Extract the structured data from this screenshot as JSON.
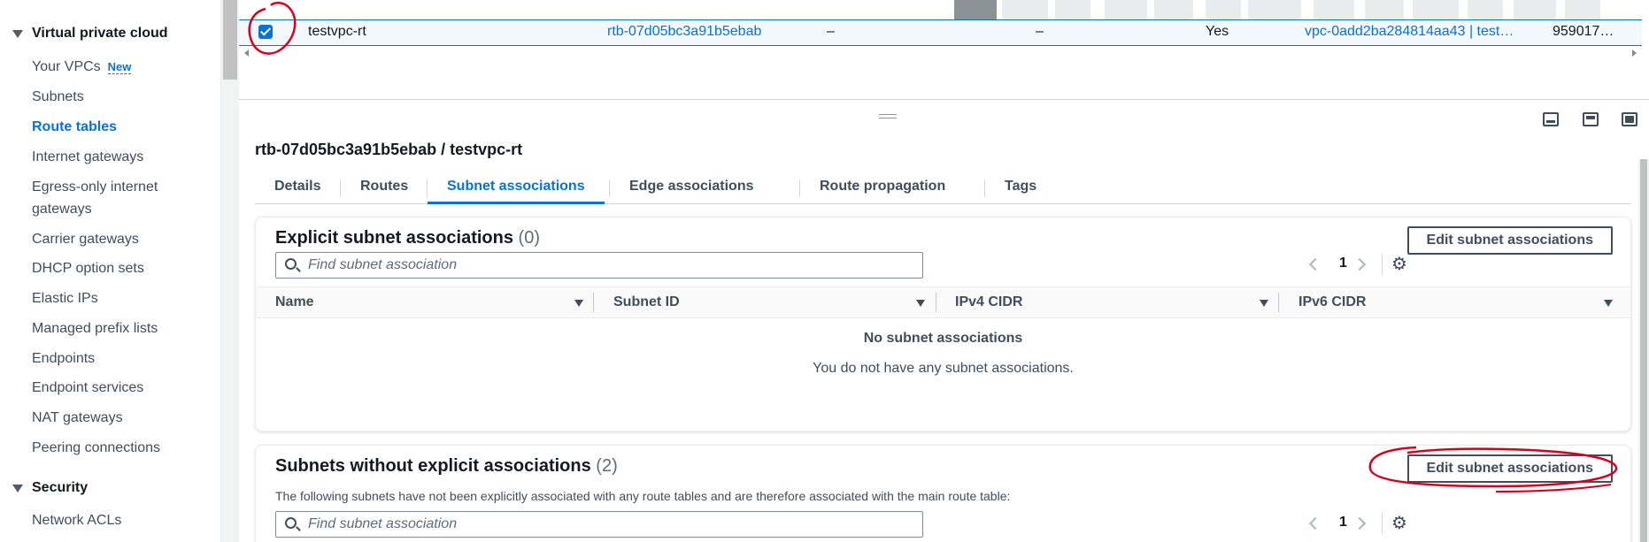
{
  "sidebar": {
    "groups": [
      {
        "label": "Virtual private cloud"
      },
      {
        "label": "Security"
      }
    ],
    "items": [
      {
        "label": "Your VPCs",
        "badge": "New"
      },
      {
        "label": "Subnets"
      },
      {
        "label": "Route tables"
      },
      {
        "label": "Internet gateways"
      },
      {
        "label": "Egress-only internet"
      },
      {
        "label": "gateways"
      },
      {
        "label": "Carrier gateways"
      },
      {
        "label": "DHCP option sets"
      },
      {
        "label": "Elastic IPs"
      },
      {
        "label": "Managed prefix lists"
      },
      {
        "label": "Endpoints"
      },
      {
        "label": "Endpoint services"
      },
      {
        "label": "NAT gateways"
      },
      {
        "label": "Peering connections"
      },
      {
        "label": "Network ACLs"
      }
    ]
  },
  "selected_row": {
    "name": "testvpc-rt",
    "route_table_id": "rtb-07d05bc3a91b5ebab",
    "explicit_subnet": "–",
    "edge": "–",
    "main": "Yes",
    "vpc": "vpc-0add2ba284814aa43 | test…",
    "owner": "959017…"
  },
  "split": {
    "title": "rtb-07d05bc3a91b5ebab / testvpc-rt",
    "tabs": [
      {
        "label": "Details"
      },
      {
        "label": "Routes"
      },
      {
        "label": "Subnet associations"
      },
      {
        "label": "Edge associations"
      },
      {
        "label": "Route propagation"
      },
      {
        "label": "Tags"
      }
    ]
  },
  "explicit": {
    "title": "Explicit subnet associations",
    "count": "(0)",
    "edit_button": "Edit subnet associations",
    "search_placeholder": "Find subnet association",
    "page": "1",
    "columns": [
      "Name",
      "Subnet ID",
      "IPv4 CIDR",
      "IPv6 CIDR"
    ],
    "empty_title": "No subnet associations",
    "empty_desc": "You do not have any subnet associations."
  },
  "without": {
    "title": "Subnets without explicit associations",
    "count": "(2)",
    "edit_button": "Edit subnet associations",
    "description": "The following subnets have not been explicitly associated with any route tables and are therefore associated with the main route table:",
    "search_placeholder": "Find subnet association",
    "page": "1"
  },
  "icons": {
    "gear": "gear-icon",
    "search": "search-icon",
    "chevron_left": "chevron-left-icon",
    "chevron_right": "chevron-right-icon"
  },
  "colors": {
    "accent": "#0972d3",
    "annotation": "#d9001b"
  }
}
